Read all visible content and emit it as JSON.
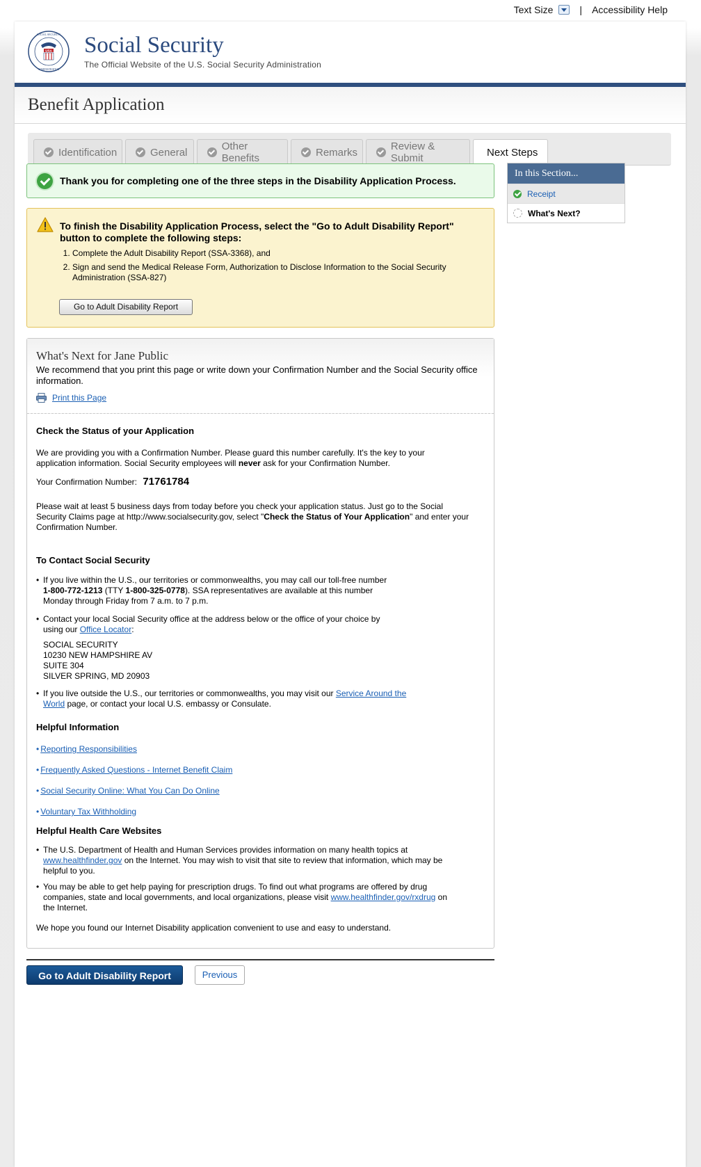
{
  "utility": {
    "text_size": "Text Size",
    "separator": "|",
    "accessibility": "Accessibility Help"
  },
  "brand": {
    "title": "Social Security",
    "subtitle": "The Official Website of the U.S. Social Security Administration",
    "seal_text": "SOCIAL SECURITY ADMINISTRATION",
    "seal_usa": "USA"
  },
  "page_title": "Benefit Application",
  "tabs": [
    {
      "label": "Identification",
      "state": "complete"
    },
    {
      "label": "General",
      "state": "complete"
    },
    {
      "label": "Other Benefits",
      "state": "complete"
    },
    {
      "label": "Remarks",
      "state": "complete"
    },
    {
      "label": "Review & Submit",
      "state": "complete"
    },
    {
      "label": "Next Steps",
      "state": "active"
    }
  ],
  "success_message": "Thank you for completing one of the three steps in the Disability Application Process.",
  "warning": {
    "heading": "To finish the Disability Application Process, select the \"Go to Adult Disability Report\" button to complete the following steps:",
    "steps": [
      "Complete the Adult Disability Report (SSA-3368), and",
      "Sign and send the Medical Release Form, Authorization to Disclose Information to the Social Security Administration (SSA-827)"
    ],
    "button": "Go to Adult Disability Report"
  },
  "next": {
    "title": "What's Next for Jane Public",
    "intro": "We recommend that you print this page or write down your Confirmation Number and the Social Security office information.",
    "print_link": "Print this Page",
    "status_heading": "Check the Status of your Application",
    "status_p1_a": "We are providing you with a Confirmation Number. Please guard this number carefully. It's the key to your application information. Social Security employees will ",
    "status_p1_b": "never",
    "status_p1_c": " ask for your Confirmation Number.",
    "conf_label": "Your Confirmation Number:",
    "conf_number": "71761784",
    "status_p2_a": "Please wait at least 5 business days from today before you check your application status. Just go to the Social Security Claims page at http://www.socialsecurity.gov, select \"",
    "status_p2_b": "Check the Status of Your Application",
    "status_p2_c": "\" and enter your Confirmation Number.",
    "contact_heading": "To Contact Social Security",
    "contact_b1_a": "If you live within the U.S., our territories or commonwealths, you may call our toll-free number ",
    "contact_b1_phone": "1-800-772-1213",
    "contact_b1_b": " (TTY ",
    "contact_b1_tty": "1-800-325-0778",
    "contact_b1_c": "). SSA representatives are available at this number Monday through Friday from 7 a.m. to 7 p.m.",
    "contact_b2_a": "Contact your local Social Security office at the address below or the office of your choice by using our ",
    "contact_b2_link": "Office Locator",
    "contact_b2_b": ":",
    "address": [
      "SOCIAL SECURITY",
      "10230 NEW HAMPSHIRE AV",
      "SUITE 304",
      "SILVER SPRING, MD 20903"
    ],
    "contact_b3_a": "If you live outside the U.S., our territories or commonwealths, you may visit our ",
    "contact_b3_link": "Service Around the World",
    "contact_b3_b": " page, or contact your local U.S. embassy or Consulate.",
    "helpful_heading": "Helpful Information",
    "helpful_links": [
      "Reporting Responsibilities",
      "Frequently Asked Questions - Internet Benefit Claim",
      "Social Security Online: What You Can Do Online",
      "Voluntary Tax Withholding"
    ],
    "health_heading": "Helpful Health Care Websites",
    "health_b1_a": "The U.S. Department of Health and Human Services provides information on many health topics at ",
    "health_b1_link": "www.healthfinder.gov",
    "health_b1_b": " on the Internet. You may wish to visit that site to review that information, which may be helpful to you.",
    "health_b2_a": "You may be able to get help paying for prescription drugs. To find out what programs are offered by drug companies, state and local governments, and local organizations, please visit ",
    "health_b2_link": "www.healthfinder.gov/rxdrug",
    "health_b2_b": " on the Internet.",
    "closing": "We hope you found our Internet Disability application convenient to use and easy to understand."
  },
  "sidebar": {
    "heading": "In this Section...",
    "items": [
      {
        "label": "Receipt",
        "state": "done"
      },
      {
        "label": "What's Next?",
        "state": "current"
      }
    ]
  },
  "footer_buttons": {
    "primary": "Go to Adult Disability Report",
    "previous": "Previous"
  },
  "colors": {
    "brand_blue": "#2f4f7f",
    "link": "#1a5fb4",
    "success_green": "#3ea342",
    "warning_bg": "#fbf3cf"
  }
}
